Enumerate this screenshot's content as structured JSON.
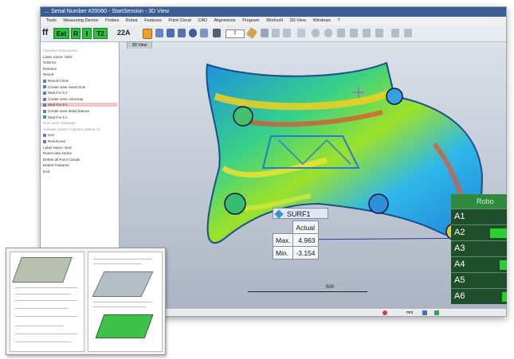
{
  "window": {
    "title": "… Serial Number #20060 - StartSession - 3D View"
  },
  "menu": [
    "Tools",
    "Measuring Device",
    "Probes",
    "Robot",
    "Features",
    "Point Cloud",
    "CAD",
    "Alignments",
    "Program",
    "Workcell",
    "3D-View",
    "Windows",
    "?"
  ],
  "toolbar": {
    "ff": "ff",
    "buttons": [
      "Ext",
      "R",
      "I",
      "T2"
    ],
    "probe": "22A",
    "combo": "2"
  },
  "view_tab": "3D View",
  "tree": [
    {
      "label": "Operator Instructions",
      "style": "grey"
    },
    {
      "label": "Laser name: Start",
      "style": "plain"
    },
    {
      "label": "OnError",
      "style": "plain"
    },
    {
      "label": "Retrieve",
      "style": "plain"
    },
    {
      "label": "Result",
      "style": "plain"
    },
    {
      "label": "Result Circle",
      "style": "icon"
    },
    {
      "label": "Create view ViewCircle",
      "style": "icon"
    },
    {
      "label": "Wait For 5 s",
      "style": "icon"
    },
    {
      "label": "Create view colormap",
      "style": "icon"
    },
    {
      "label": "Wait For 5 s",
      "style": "selected"
    },
    {
      "label": "Create view detail feature",
      "style": "icon"
    },
    {
      "label": "Wait For 5 s",
      "style": "icon"
    },
    {
      "label": "Text value Message",
      "style": "grey"
    },
    {
      "label": "Activate Current Camera (Name in)",
      "style": "grey"
    },
    {
      "label": "end",
      "style": "icon"
    },
    {
      "label": "Result end",
      "style": "icon"
    },
    {
      "label": "Label Name: End",
      "style": "plain"
    },
    {
      "label": "Reset view Home",
      "style": "plain"
    },
    {
      "label": "Delete all Point Clouds",
      "style": "plain"
    },
    {
      "label": "Delete Features",
      "style": "plain"
    },
    {
      "label": "End",
      "style": "plain"
    }
  ],
  "surf": {
    "title": "SURF1",
    "column": "Actual",
    "rows": [
      {
        "label": "Max.",
        "value": "4.963"
      },
      {
        "label": "Min.",
        "value": "-3.154"
      }
    ]
  },
  "robot_panel": {
    "header": "Robo",
    "rows": [
      {
        "label": "A1",
        "fill": 0.0
      },
      {
        "label": "A2",
        "fill": 0.7
      },
      {
        "label": "A3",
        "fill": 0.0
      },
      {
        "label": "A4",
        "fill": 0.3
      },
      {
        "label": "A5",
        "fill": 0.0
      },
      {
        "label": "A6",
        "fill": 0.2
      }
    ]
  },
  "scale_label": "500",
  "status": {
    "unit": "mm"
  },
  "colors": {
    "accent": "#3b5d93",
    "ok_green": "#29d12c",
    "panel_green": "#1f4f2a"
  }
}
